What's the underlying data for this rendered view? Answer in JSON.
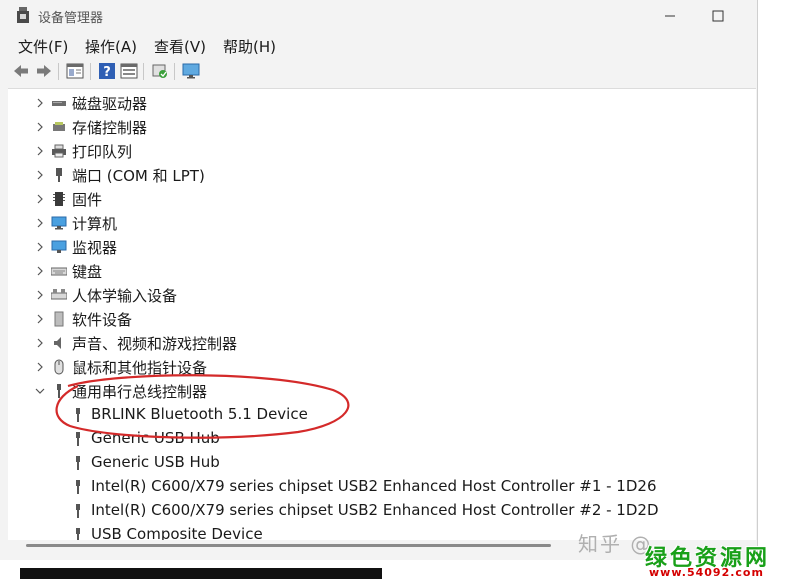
{
  "window": {
    "title": "设备管理器"
  },
  "menu": [
    {
      "label": "文件(F)"
    },
    {
      "label": "操作(A)"
    },
    {
      "label": "查看(V)"
    },
    {
      "label": "帮助(H)"
    }
  ],
  "toolbar": {
    "icons": [
      "back-arrow-icon",
      "forward-arrow-icon",
      "properties-icon",
      "help-icon",
      "view-icon",
      "update-driver-icon",
      "monitor-icon"
    ]
  },
  "tree": {
    "items": [
      {
        "label": "磁盘驱动器",
        "icon": "disk-drive-icon",
        "expanded": false
      },
      {
        "label": "存储控制器",
        "icon": "storage-controller-icon",
        "expanded": false
      },
      {
        "label": "打印队列",
        "icon": "printer-icon",
        "expanded": false
      },
      {
        "label": "端口 (COM 和 LPT)",
        "icon": "port-icon",
        "expanded": false
      },
      {
        "label": "固件",
        "icon": "firmware-icon",
        "expanded": false
      },
      {
        "label": "计算机",
        "icon": "computer-icon",
        "expanded": false
      },
      {
        "label": "监视器",
        "icon": "monitor-icon",
        "expanded": false
      },
      {
        "label": "键盘",
        "icon": "keyboard-icon",
        "expanded": false
      },
      {
        "label": "人体学输入设备",
        "icon": "hid-icon",
        "expanded": false
      },
      {
        "label": "软件设备",
        "icon": "software-device-icon",
        "expanded": false
      },
      {
        "label": "声音、视频和游戏控制器",
        "icon": "sound-icon",
        "expanded": false
      },
      {
        "label": "鼠标和其他指针设备",
        "icon": "mouse-icon",
        "expanded": false
      },
      {
        "label": "通用串行总线控制器",
        "icon": "usb-icon",
        "expanded": true
      }
    ],
    "children": [
      {
        "label": "BRLINK Bluetooth 5.1 Device"
      },
      {
        "label": "Generic USB Hub"
      },
      {
        "label": "Generic USB Hub"
      },
      {
        "label": "Intel(R) C600/X79 series chipset USB2 Enhanced Host Controller #1 - 1D26"
      },
      {
        "label": "Intel(R) C600/X79 series chipset USB2 Enhanced Host Controller #2 - 1D2D"
      },
      {
        "label": "USB Composite Device"
      }
    ]
  },
  "watermark": {
    "zhihu": "知乎 @",
    "site": "绿色资源网",
    "url": "www.54092.com"
  },
  "colors": {
    "highlight": "#d42a2a",
    "watermark_green": "#19a019",
    "watermark_red": "#d40000"
  }
}
